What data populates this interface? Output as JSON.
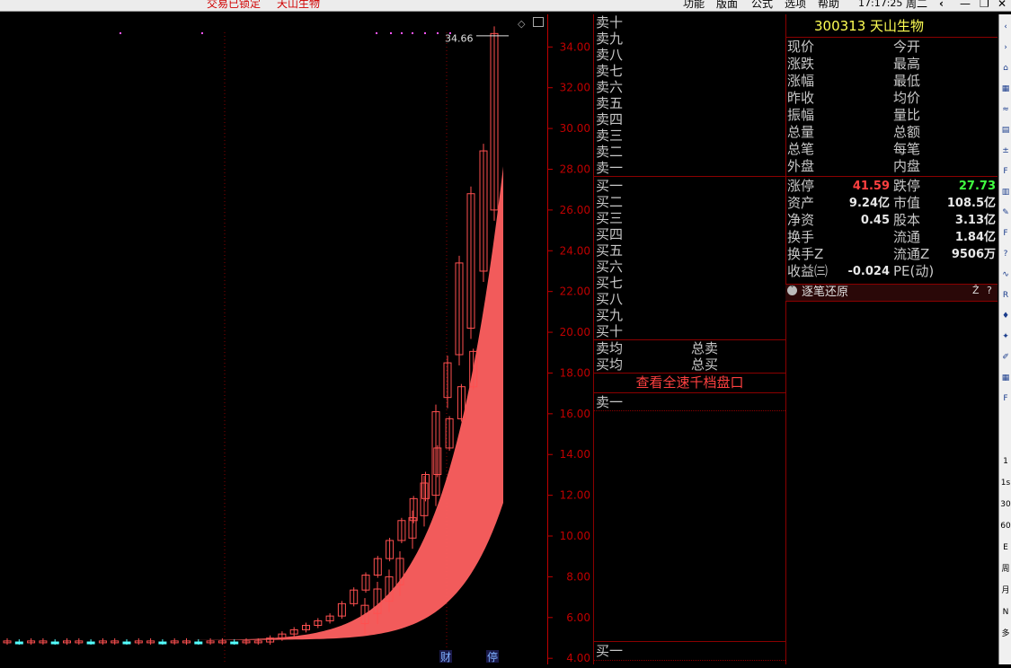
{
  "topbar": {
    "status": "交易已锁定",
    "stock_name": "天山生物",
    "menus": [
      "功能",
      "版面",
      "公式",
      "选项",
      "帮助"
    ],
    "time": "17:17:25",
    "weekday": "周二"
  },
  "chart_data": {
    "type": "candlestick",
    "ylim": [
      3.7,
      35.6
    ],
    "yticks": [
      "34.00",
      "32.00",
      "30.00",
      "28.00",
      "26.00",
      "24.00",
      "22.00",
      "20.00",
      "18.00",
      "16.00",
      "14.00",
      "12.00",
      "10.00",
      "8.00",
      "6.00",
      "4.00"
    ],
    "max_label": "34.66",
    "markers": [
      "财",
      "停"
    ],
    "colors": {
      "up": "#ff5050",
      "band": "#ff6060",
      "flat": "#54ffff",
      "axis": "#c00000"
    }
  },
  "book": {
    "sell_labels": [
      "卖十",
      "卖九",
      "卖八",
      "卖七",
      "卖六",
      "卖五",
      "卖四",
      "卖三",
      "卖二",
      "卖一"
    ],
    "buy_labels": [
      "买一",
      "买二",
      "买三",
      "买四",
      "买五",
      "买六",
      "买七",
      "买八",
      "买九",
      "买十"
    ],
    "sell_avg": "卖均",
    "buy_avg": "买均",
    "total_sell": "总卖",
    "total_buy": "总买",
    "full_depth_link": "查看全速千档盘口",
    "ticker_top": "卖一",
    "ticker_bottom": "买一"
  },
  "quote": {
    "header": "300313 天山生物",
    "rows_left": [
      "现价",
      "涨跌",
      "涨幅",
      "昨收",
      "振幅",
      "总量",
      "总笔",
      "外盘"
    ],
    "rows_right": [
      "今开",
      "最高",
      "最低",
      "均价",
      "量比",
      "总额",
      "每笔",
      "内盘"
    ],
    "stats": [
      {
        "l": "涨停",
        "lv": "41.59",
        "r": "跌停",
        "rv": "27.73"
      },
      {
        "l": "资产",
        "lv": "9.24亿",
        "r": "市值",
        "rv": "108.5亿"
      },
      {
        "l": "净资",
        "lv": "0.45",
        "r": "股本",
        "rv": "3.13亿"
      },
      {
        "l": "换手",
        "lv": "",
        "r": "流通",
        "rv": "1.84亿"
      },
      {
        "l": "换手Z",
        "lv": "",
        "r": "流通Z",
        "rv": "9506万"
      },
      {
        "l": "收益㈢",
        "lv": "-0.024",
        "r": "PE(动)",
        "rv": ""
      }
    ],
    "tick_restore": "逐笔还原",
    "colors": {
      "limit_up": "#ff4040",
      "limit_down": "#40ff40",
      "header": "#ffff54"
    }
  },
  "side_icons": [
    "arrow-left-icon",
    "arrow-right-icon",
    "chart-icon",
    "grid-icon",
    "line-icon",
    "table-icon",
    "plus-minus-icon",
    "f10-icon",
    "list-icon",
    "edit-icon",
    "fund-icon",
    "question-icon",
    "signal-icon",
    "rs-icon",
    "bell-icon",
    "compass-icon",
    "pencil-icon",
    "grid2-icon",
    "fa-icon"
  ],
  "side_texts": [
    "1",
    "1s",
    "30",
    "60",
    "E",
    "周",
    "月",
    "N",
    "多"
  ]
}
